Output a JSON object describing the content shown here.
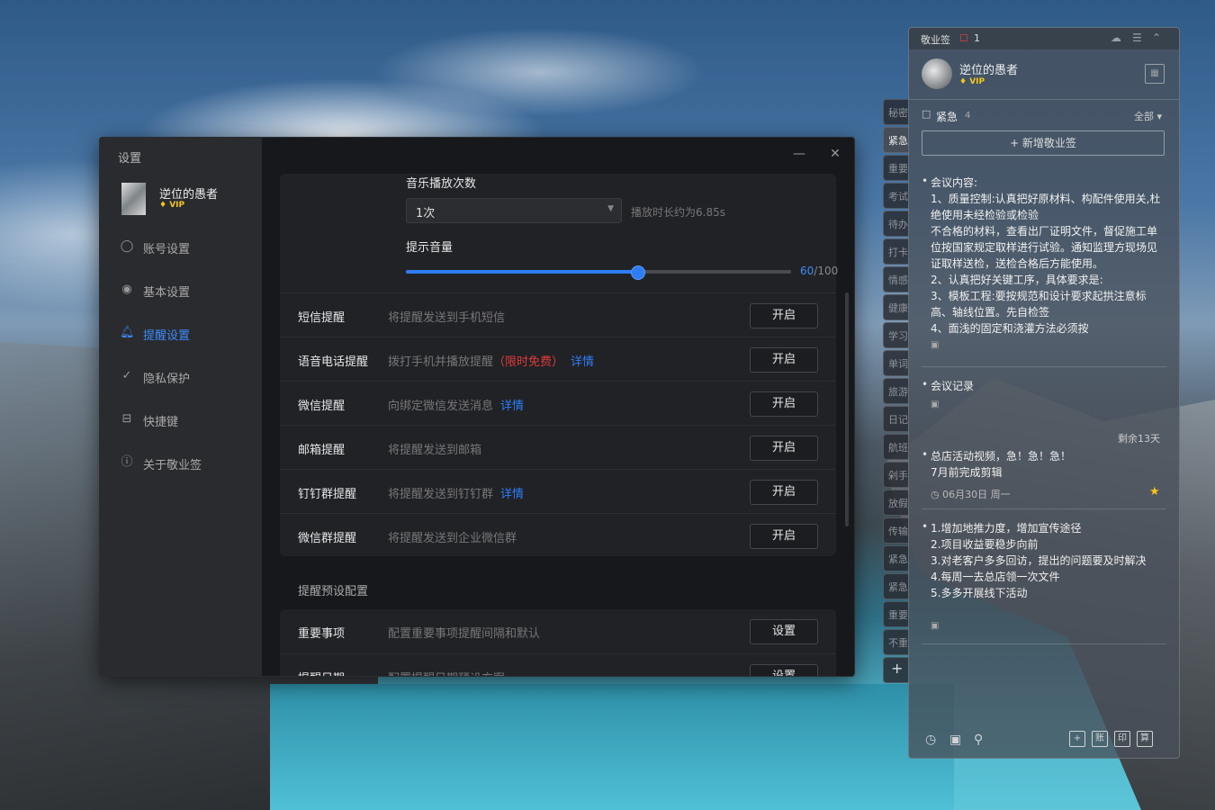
{
  "settings": {
    "window_title": "设置",
    "user": {
      "name": "逆位的愚者",
      "vip": "VIP"
    },
    "nav": [
      {
        "label": "账号设置",
        "icon": "user-icon"
      },
      {
        "label": "基本设置",
        "icon": "settings-icon"
      },
      {
        "label": "提醒设置",
        "icon": "bell-icon",
        "active": true
      },
      {
        "label": "隐私保护",
        "icon": "shield-icon"
      },
      {
        "label": "快捷键",
        "icon": "keyboard-icon"
      },
      {
        "label": "关于敬业签",
        "icon": "info-icon"
      }
    ],
    "music_repeat": {
      "label": "音乐播放次数",
      "value": "1次",
      "hint": "播放时长约为6.85s"
    },
    "volume": {
      "label": "提示音量",
      "value": "60",
      "max": "/100",
      "fraction": 0.6
    },
    "reminders": [
      {
        "name": "短信提醒",
        "desc": "将提醒发送到手机短信",
        "button": "开启"
      },
      {
        "name": "语音电话提醒",
        "desc": "拨打手机并播放提醒",
        "badge": "（限时免费）",
        "link": "详情",
        "button": "开启"
      },
      {
        "name": "微信提醒",
        "desc": "向绑定微信发送消息",
        "link": "详情",
        "button": "开启"
      },
      {
        "name": "邮箱提醒",
        "desc": "将提醒发送到邮箱",
        "button": "开启"
      },
      {
        "name": "钉钉群提醒",
        "desc": "将提醒发送到钉钉群",
        "link": "详情",
        "button": "开启"
      },
      {
        "name": "微信群提醒",
        "desc": "将提醒发送到企业微信群",
        "button": "开启"
      }
    ],
    "preset_section": "提醒预设配置",
    "presets": [
      {
        "name": "重要事项",
        "desc": "配置重要事项提醒间隔和默认",
        "button": "设置"
      },
      {
        "name": "提醒日期",
        "desc": "配置提醒日期预设方案",
        "button": "设置"
      }
    ]
  },
  "side_tabs": [
    "秘密",
    "紧急",
    "重要",
    "考试",
    "待办",
    "打卡",
    "情感",
    "健康",
    "学习",
    "单词",
    "旅游",
    "日记",
    "航班",
    "剁手",
    "放假",
    "传输",
    "紧急",
    "紧急",
    "重要",
    "不重要"
  ],
  "side_tab_active": 1,
  "note": {
    "app_name": "敬业签",
    "bell_count": "1",
    "user": {
      "name": "逆位的愚者",
      "vip": "VIP"
    },
    "category": "紧急",
    "category_count": "4",
    "filter": "全部 ▾",
    "add_button": "+ 新增敬业签",
    "items": [
      {
        "text": "会议内容:\n1、质量控制:认真把好原材料、构配件使用关,杜绝使用未经检验或检验\n不合格的材料，查看出厂证明文件，督促施工单位按国家规定取样进行试验。通知监理方现场见证取样送检，送检合格后方能使用。\n2、认真把好关键工序，具体要求是:\n3、模板工程:要按规范和设计要求起拱注意标高、轴线位置。先自检签\n4、面浅的固定和浇灌方法必须按"
      },
      {
        "text": "会议记录"
      },
      {
        "text": "总店活动视频，急！急！急！\n7月前完成剪辑",
        "remaining": "剩余13天",
        "date": "06月30日 周一"
      },
      {
        "text": "1.增加地推力度，增加宣传途径\n2.项目收益要稳步向前\n3.对老客户多多回访，提出的问题要及时解决\n4.每周一去总店领一次文件\n5.多多开展线下活动"
      }
    ],
    "bottom_right": [
      "+",
      "账",
      "印",
      "算"
    ]
  },
  "colors": {
    "accent": "#2e7df6",
    "free_badge": "#e03a3a",
    "vip": "#f5c518"
  }
}
